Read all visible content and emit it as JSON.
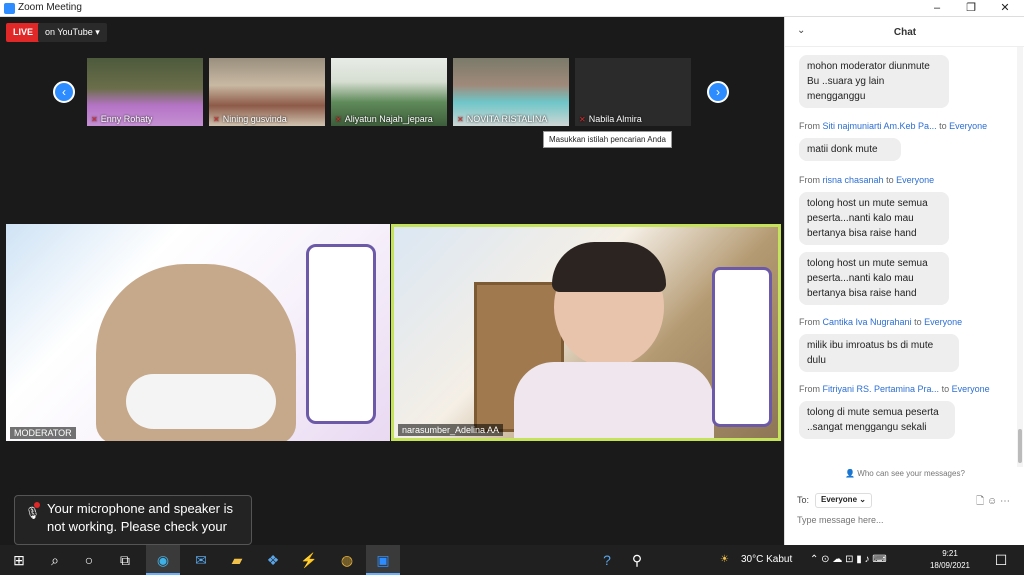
{
  "window": {
    "title": "Zoom Meeting",
    "controls": [
      "–",
      "❐",
      "✕"
    ]
  },
  "stream": {
    "live_label": "LIVE",
    "platform_label": "on YouTube ▾"
  },
  "gallery": {
    "prev_arrow": "‹",
    "next_arrow": "›",
    "participants": [
      {
        "name": "Enny Rohaty",
        "muted": true
      },
      {
        "name": "Nining gusvinda",
        "muted": true
      },
      {
        "name": "Aliyatun Najah_jepara",
        "muted": true
      },
      {
        "name": "NOVITA RISTALINA",
        "muted": true
      },
      {
        "name": "Nabila Almira",
        "muted": true
      }
    ]
  },
  "tooltip": "Masukkan istilah pencarian Anda",
  "videos": {
    "left_label": "MODERATOR",
    "right_label": "narasumber_Adelina AA"
  },
  "notice": {
    "text": "Your microphone and speaker is not working. Please check your"
  },
  "chat": {
    "title": "Chat",
    "messages": [
      {
        "from": "",
        "to": "",
        "text": "mohon moderator diunmute Bu ..suara yg lain mengganggu"
      },
      {
        "from": "Siti najmuniarti Am.Keb Pa...",
        "to": "Everyone",
        "text": "matii  donk  mute"
      },
      {
        "from": "risna chasanah",
        "to": "Everyone",
        "text": "tolong host un mute semua peserta...nanti kalo mau bertanya bisa raise hand"
      },
      {
        "from": "",
        "to": "",
        "text": "tolong host un mute semua peserta...nanti kalo mau bertanya bisa raise hand"
      },
      {
        "from": "Cantika Iva Nugrahani",
        "to": "Everyone",
        "text": "milik ibu imroatus bs di mute dulu"
      },
      {
        "from": "Fitriyani RS. Pertamina Pra...",
        "to": "Everyone",
        "text": "tolong di mute semua peserta ..sangat menggangu sekali"
      }
    ],
    "from_prefix": "From",
    "to_word": "to",
    "who_can_see": "Who can see your messages?",
    "to_label": "To:",
    "recipient": "Everyone ⌄",
    "input_placeholder": "Type message here..."
  },
  "taskbar": {
    "weather": "30°C  Kabut",
    "time": "9:21",
    "date": "18/09/2021"
  },
  "colors": {
    "zoom_blue": "#2d8cff",
    "live_red": "#e02828",
    "speaker_highlight": "#c5e35a"
  }
}
